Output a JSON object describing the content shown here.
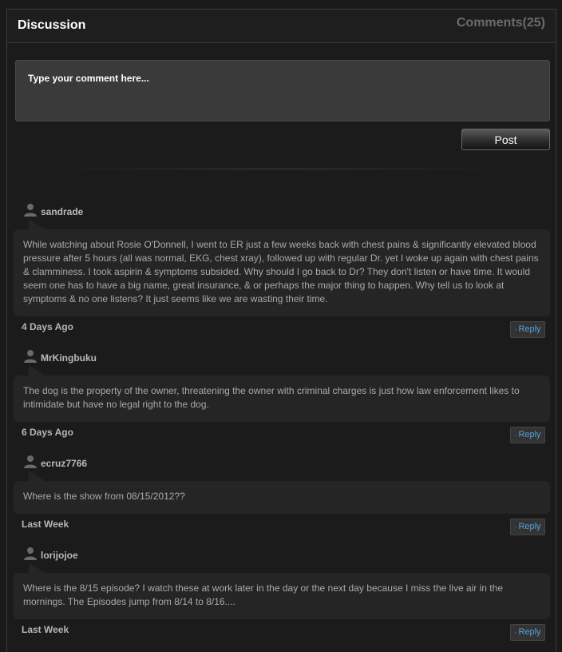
{
  "header": {
    "title": "Discussion",
    "comments_count": "Comments(25)"
  },
  "compose": {
    "placeholder": "Type your comment here...",
    "post_label": "Post"
  },
  "comments": [
    {
      "username": "sandrade",
      "text": "While watching about Rosie O'Donnell, I went to ER just a few weeks back with chest pains & significantly elevated blood pressure after 5 hours (all was normal, EKG, chest xray), followed up with regular Dr. yet I woke up again with chest pains & clamminess. I took aspirin & symptoms subsided. Why should I go back to Dr? They don't listen or have time. It would seem one has to have a big name, great insurance, & or perhaps the major thing to happen. Why tell us to look at symptoms & no one listens? It just seems like we are wasting their time.",
      "time": "4 Days Ago",
      "reply_label": "Reply"
    },
    {
      "username": "MrKingbuku",
      "text": "The dog is the property of the owner, threatening the owner with criminal charges is just how law enforcement likes to intimidate but have no legal right to the dog.",
      "time": "6 Days Ago",
      "reply_label": "Reply"
    },
    {
      "username": "ecruz7766",
      "text": "Where is the show from 08/15/2012??",
      "time": "Last Week",
      "reply_label": "Reply"
    },
    {
      "username": "lorijojoe",
      "text": "Where is the 8/15 episode? I watch these at work later in the day or the next day because I miss the live air in the mornings. The Episodes jump from 8/14 to 8/16....",
      "time": "Last Week",
      "reply_label": "Reply"
    }
  ],
  "icons": {
    "user": "user-silhouette-icon",
    "reply_bullet": "·"
  },
  "colors": {
    "background": "#1b1b1b",
    "bubble": "#252525",
    "link": "#4fa3d9"
  }
}
